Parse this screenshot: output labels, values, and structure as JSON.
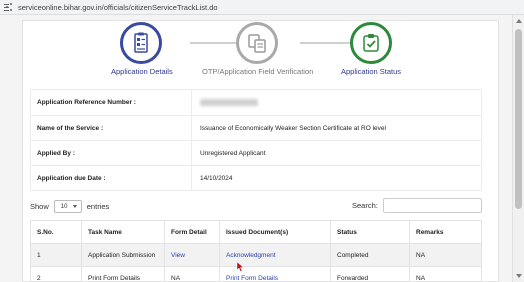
{
  "browser": {
    "url": "serviceonline.bihar.gov.in/officials/citizenServiceTrackList.do"
  },
  "steps": [
    {
      "label": "Application Details",
      "icon": "document-form-icon",
      "color": "#3a4aa0"
    },
    {
      "label": "OTP/Application Field Verification",
      "icon": "verification-icon",
      "color": "#a9a9a9"
    },
    {
      "label": "Application Status",
      "icon": "status-icon",
      "color": "#2e8a3a"
    }
  ],
  "info": {
    "ref_label": "Application Reference Number :",
    "ref_value": "",
    "service_label": "Name of the Service :",
    "service_value": "Issuance of Economically Weaker Section Certificate at RO level",
    "applied_label": "Applied By :",
    "applied_value": "Unregistered Applicant",
    "due_label": "Application due Date :",
    "due_value": "14/10/2024"
  },
  "controls": {
    "show_label": "Show",
    "entries_value": "10",
    "entries_label": "entries",
    "search_label": "Search:"
  },
  "table": {
    "headers": [
      "S.No.",
      "Task Name",
      "Form Detail",
      "Issued Document(s)",
      "Status",
      "Remarks"
    ],
    "rows": [
      {
        "sno": "1",
        "task": "Application Submission",
        "form": "View",
        "doc": "Acknowledgment",
        "status": "Completed",
        "remarks": "NA"
      },
      {
        "sno": "2",
        "task": "Print Form Details",
        "form": "NA",
        "doc": "Print Form Details",
        "status": "Forwarded",
        "remarks": "NA"
      }
    ]
  }
}
